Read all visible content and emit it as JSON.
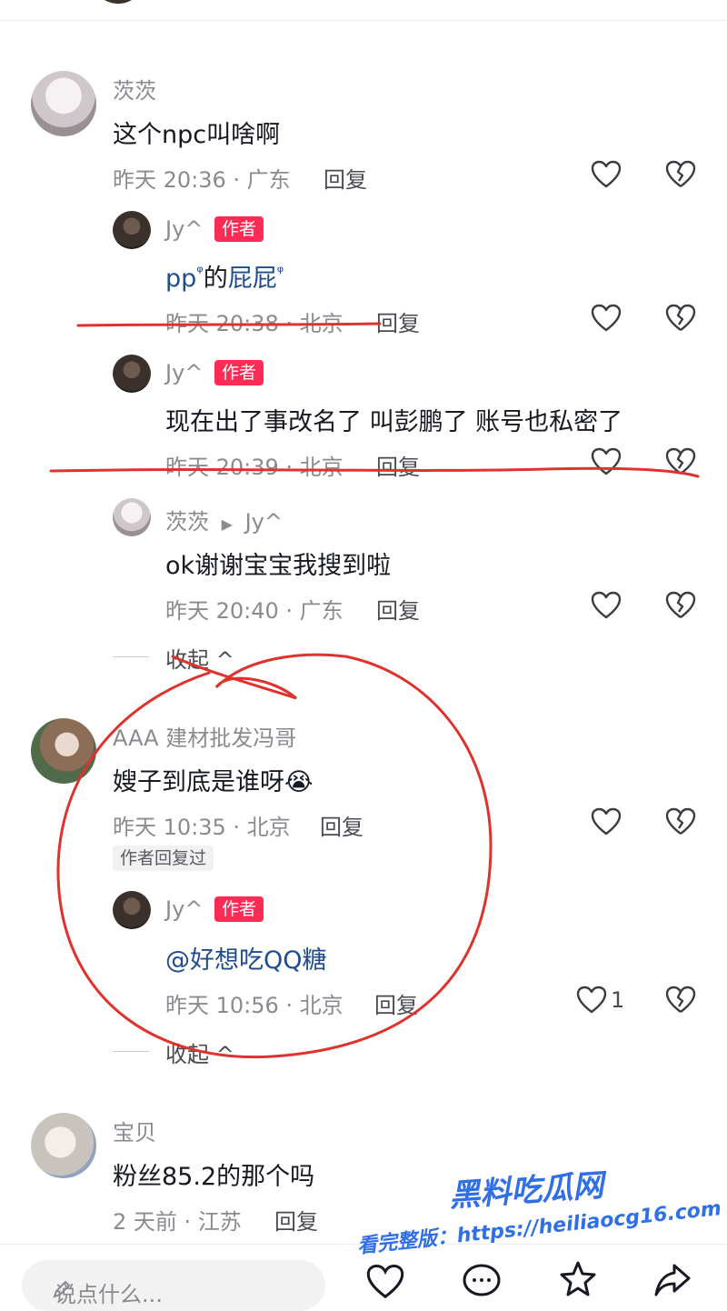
{
  "comments": [
    {
      "user": "茨茨",
      "text": "这个npc叫啥啊",
      "meta": "昨天 20:36 · 广东",
      "reply_label": "回复"
    },
    {
      "user": "AAA 建材批发冯哥",
      "text": "嫂子到底是谁呀",
      "emoji": "😭",
      "meta": "昨天 10:35 · 北京",
      "reply_label": "回复",
      "tag": "作者回复过"
    },
    {
      "user": "宝贝",
      "text": "粉丝85.2的那个吗",
      "meta": "2 天前 · 江苏",
      "reply_label": "回复"
    }
  ],
  "replies": [
    {
      "user": "Jy^",
      "badge": "作者",
      "text_part1": "pp",
      "text_mid": "的",
      "text_part2": "屁屁",
      "search_mark": "ᵠ",
      "meta": "昨天 20:38 · 北京",
      "reply_label": "回复"
    },
    {
      "user": "Jy^",
      "badge": "作者",
      "text": "现在出了事改名了 叫彭鹏了 账号也私密了",
      "meta": "昨天 20:39 · 北京",
      "reply_label": "回复"
    },
    {
      "user": "茨茨",
      "arrow": "▶",
      "reply_to": "Jy^",
      "text": "ok谢谢宝宝我搜到啦",
      "meta": "昨天 20:40 · 广东",
      "reply_label": "回复"
    },
    {
      "user": "Jy^",
      "badge": "作者",
      "text": "@好想吃QQ糖",
      "meta": "昨天 10:56 · 北京",
      "reply_label": "回复",
      "likes": "1"
    }
  ],
  "collapse_label": "收起 ^",
  "input_placeholder": "说点什么...",
  "watermark": {
    "title": "黑料吃瓜网",
    "url": "看完整版：https://heiliaocg16.com"
  },
  "colors": {
    "badge": "#fe2c55",
    "link": "#1f4c8f",
    "annotation": "#e0322d",
    "watermark": "#2f6fe8"
  },
  "icons": [
    "heart-outline-icon",
    "broken-heart-icon",
    "search-mark-icon",
    "comment-icon",
    "star-icon",
    "share-icon"
  ]
}
